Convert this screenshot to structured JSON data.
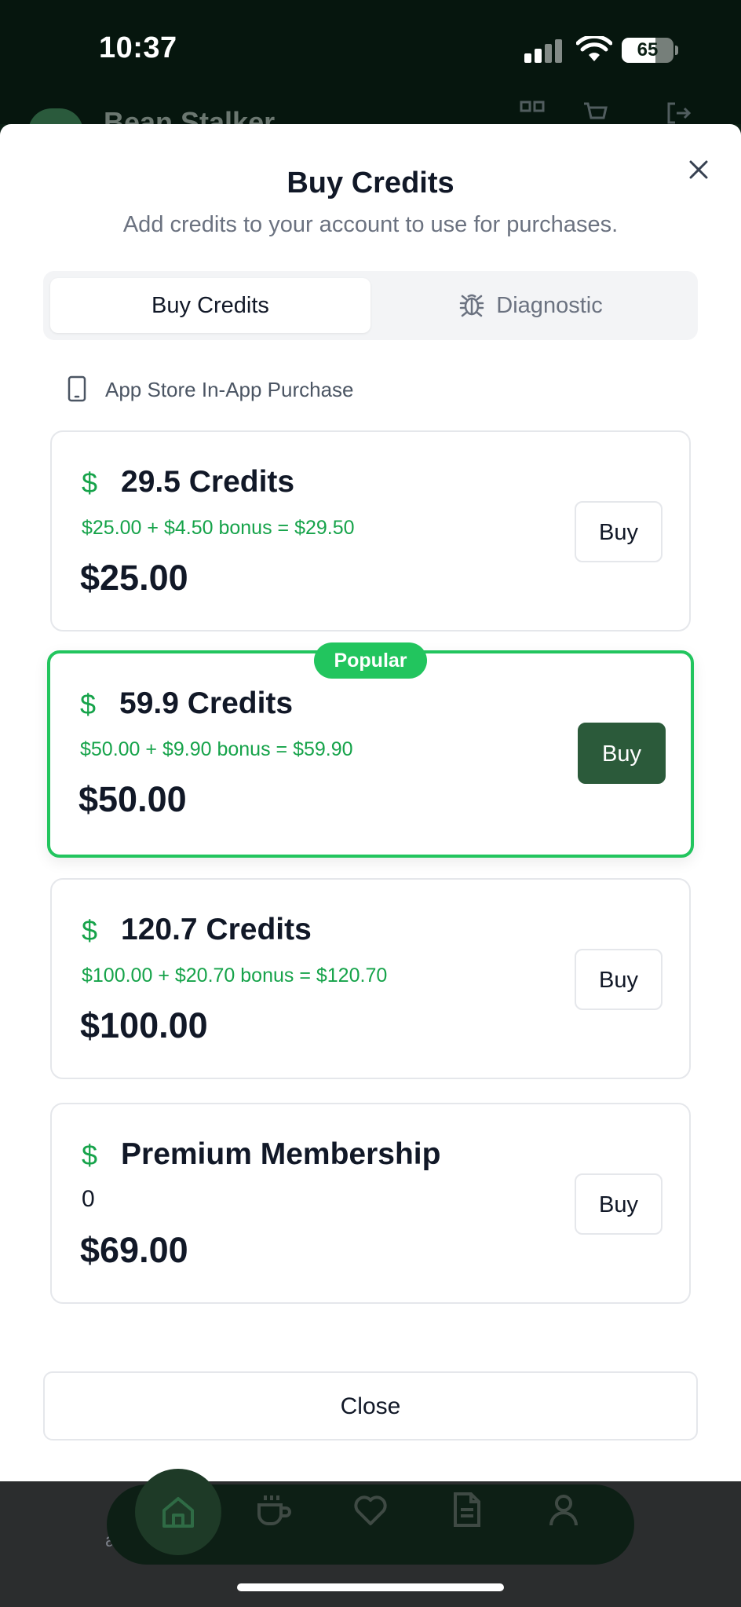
{
  "status_bar": {
    "time": "10:37",
    "battery": "65",
    "battery_level": 0.65
  },
  "background": {
    "app_title": "Bean Stalker",
    "bottom_text": "a"
  },
  "sheet": {
    "title": "Buy Credits",
    "subtitle": "Add credits to your account to use for purchases.",
    "tabs": [
      {
        "label": "Buy Credits",
        "active": true
      },
      {
        "label": "Diagnostic",
        "active": false,
        "icon": "bug-icon"
      }
    ],
    "source_label": "App Store In-App Purchase",
    "packages": [
      {
        "name": "29.5 Credits",
        "detail": "$25.00 + $4.50 bonus = $29.50",
        "price": "$25.00",
        "buy_label": "Buy",
        "popular": false
      },
      {
        "name": "59.9 Credits",
        "detail": "$50.00 + $9.90 bonus = $59.90",
        "price": "$50.00",
        "buy_label": "Buy",
        "popular": true,
        "badge": "Popular"
      },
      {
        "name": "120.7 Credits",
        "detail": "$100.00 + $20.70 bonus = $120.70",
        "price": "$100.00",
        "buy_label": "Buy",
        "popular": false
      },
      {
        "name": "Premium Membership",
        "detail": "0",
        "price": "$69.00",
        "buy_label": "Buy",
        "popular": false
      }
    ],
    "close_label": "Close"
  },
  "colors": {
    "accent": "#22c55e",
    "accent_text": "#16a34a",
    "primary_button": "#2b5a3a",
    "dark_bg": "#06160e"
  },
  "currency_symbol": "$"
}
